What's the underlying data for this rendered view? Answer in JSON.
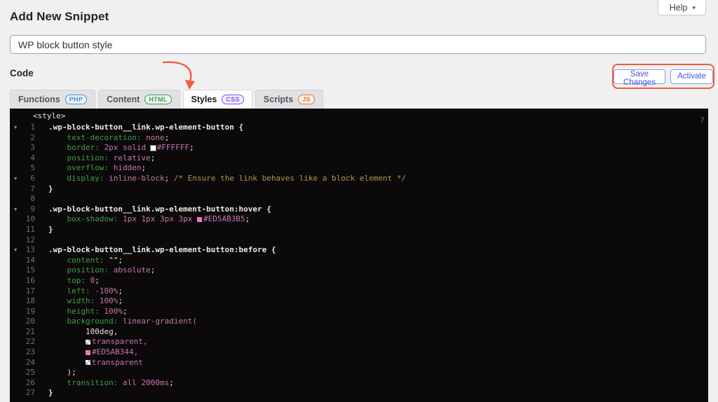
{
  "header": {
    "title": "Add New Snippet",
    "help_label": "Help",
    "help_caret": "▾"
  },
  "snippet": {
    "title_value": "WP block button style"
  },
  "code_section": {
    "label": "Code"
  },
  "actions": {
    "save_label": "Save Changes",
    "activate_label": "Activate"
  },
  "annotation": {
    "color": "#f15c3d"
  },
  "tabs": [
    {
      "label": "Functions",
      "badge": "PHP",
      "badge_color": "#4a8fd3",
      "badge_bg": "#eef4fb",
      "active": false
    },
    {
      "label": "Content",
      "badge": "HTML",
      "badge_color": "#42995a",
      "badge_bg": "#edf6ef",
      "active": false
    },
    {
      "label": "Styles",
      "badge": "CSS",
      "badge_color": "#8055f0",
      "badge_bg": "#f3eefe",
      "active": true
    },
    {
      "label": "Scripts",
      "badge": "JS",
      "badge_color": "#de7430",
      "badge_bg": "#fdf2ea",
      "active": false
    }
  ],
  "editor": {
    "bg": "#0c090a",
    "help_icon": "?",
    "header_line": "<style>",
    "fold_glyph": "▼",
    "colors": {
      "selector": "#ece9e6",
      "property": "#3da044",
      "value": "#c478ad",
      "comment": "#ab9b4a",
      "plain": "#e6e3df",
      "line_number": "#707070",
      "fold": "#8f8f8f"
    },
    "swatches": {
      "white": "#FFFFFF",
      "pink": "#ED5AB3"
    },
    "lines": [
      {
        "n": 1,
        "fold": true,
        "segs": [
          [
            "sel",
            ".wp-block-button__link.wp-element-button {"
          ]
        ]
      },
      {
        "n": 2,
        "fold": false,
        "segs": [
          [
            "plain",
            "    "
          ],
          [
            "prop",
            "text-decoration:"
          ],
          [
            "plain",
            " "
          ],
          [
            "val",
            "none"
          ],
          [
            "plain",
            ";"
          ]
        ]
      },
      {
        "n": 3,
        "fold": false,
        "segs": [
          [
            "plain",
            "    "
          ],
          [
            "prop",
            "border:"
          ],
          [
            "plain",
            " "
          ],
          [
            "val",
            "2px solid "
          ],
          [
            "sw",
            "white"
          ],
          [
            "val",
            "#FFFFFF"
          ],
          [
            "plain",
            ";"
          ]
        ]
      },
      {
        "n": 4,
        "fold": false,
        "segs": [
          [
            "plain",
            "    "
          ],
          [
            "prop",
            "position:"
          ],
          [
            "plain",
            " "
          ],
          [
            "val",
            "relative"
          ],
          [
            "plain",
            ";"
          ]
        ]
      },
      {
        "n": 5,
        "fold": false,
        "segs": [
          [
            "plain",
            "    "
          ],
          [
            "prop",
            "overflow:"
          ],
          [
            "plain",
            " "
          ],
          [
            "val",
            "hidden"
          ],
          [
            "plain",
            ";"
          ]
        ]
      },
      {
        "n": 6,
        "fold": true,
        "segs": [
          [
            "plain",
            "    "
          ],
          [
            "prop",
            "display:"
          ],
          [
            "plain",
            " "
          ],
          [
            "val",
            "inline-block"
          ],
          [
            "plain",
            "; "
          ],
          [
            "comment",
            "/* Ensure the link behaves like a block element */"
          ]
        ]
      },
      {
        "n": 7,
        "fold": false,
        "segs": [
          [
            "sel",
            "}"
          ]
        ]
      },
      {
        "n": 8,
        "fold": false,
        "segs": []
      },
      {
        "n": 9,
        "fold": true,
        "segs": [
          [
            "sel",
            ".wp-block-button__link.wp-element-button:hover {"
          ]
        ]
      },
      {
        "n": 10,
        "fold": false,
        "segs": [
          [
            "plain",
            "    "
          ],
          [
            "prop",
            "box-shadow:"
          ],
          [
            "plain",
            " "
          ],
          [
            "val",
            "1px 1px 3px 3px "
          ],
          [
            "sw",
            "pink"
          ],
          [
            "val",
            "#ED5AB3B5"
          ],
          [
            "plain",
            ";"
          ]
        ]
      },
      {
        "n": 11,
        "fold": false,
        "segs": [
          [
            "sel",
            "}"
          ]
        ]
      },
      {
        "n": 12,
        "fold": false,
        "segs": []
      },
      {
        "n": 13,
        "fold": true,
        "segs": [
          [
            "sel",
            ".wp-block-button__link.wp-element-button:before {"
          ]
        ]
      },
      {
        "n": 14,
        "fold": false,
        "segs": [
          [
            "plain",
            "    "
          ],
          [
            "prop",
            "content:"
          ],
          [
            "plain",
            " \"\";"
          ]
        ]
      },
      {
        "n": 15,
        "fold": false,
        "segs": [
          [
            "plain",
            "    "
          ],
          [
            "prop",
            "position:"
          ],
          [
            "plain",
            " "
          ],
          [
            "val",
            "absolute"
          ],
          [
            "plain",
            ";"
          ]
        ]
      },
      {
        "n": 16,
        "fold": false,
        "segs": [
          [
            "plain",
            "    "
          ],
          [
            "prop",
            "top:"
          ],
          [
            "plain",
            " "
          ],
          [
            "val",
            "0"
          ],
          [
            "plain",
            ";"
          ]
        ]
      },
      {
        "n": 17,
        "fold": false,
        "segs": [
          [
            "plain",
            "    "
          ],
          [
            "prop",
            "left:"
          ],
          [
            "plain",
            " "
          ],
          [
            "val",
            "-100%"
          ],
          [
            "plain",
            ";"
          ]
        ]
      },
      {
        "n": 18,
        "fold": false,
        "segs": [
          [
            "plain",
            "    "
          ],
          [
            "prop",
            "width:"
          ],
          [
            "plain",
            " "
          ],
          [
            "val",
            "100%"
          ],
          [
            "plain",
            ";"
          ]
        ]
      },
      {
        "n": 19,
        "fold": false,
        "segs": [
          [
            "plain",
            "    "
          ],
          [
            "prop",
            "height:"
          ],
          [
            "plain",
            " "
          ],
          [
            "val",
            "100%"
          ],
          [
            "plain",
            ";"
          ]
        ]
      },
      {
        "n": 20,
        "fold": false,
        "segs": [
          [
            "plain",
            "    "
          ],
          [
            "prop",
            "background:"
          ],
          [
            "plain",
            " "
          ],
          [
            "val",
            "linear-gradient("
          ]
        ]
      },
      {
        "n": 21,
        "fold": false,
        "segs": [
          [
            "plain",
            "        100deg,"
          ]
        ]
      },
      {
        "n": 22,
        "fold": false,
        "segs": [
          [
            "plain",
            "        "
          ],
          [
            "sw",
            "checker"
          ],
          [
            "val",
            "transparent,"
          ]
        ]
      },
      {
        "n": 23,
        "fold": false,
        "segs": [
          [
            "plain",
            "        "
          ],
          [
            "sw",
            "pink"
          ],
          [
            "val",
            "#ED5AB344,"
          ]
        ]
      },
      {
        "n": 24,
        "fold": false,
        "segs": [
          [
            "plain",
            "        "
          ],
          [
            "sw",
            "checker"
          ],
          [
            "val",
            "transparent"
          ]
        ]
      },
      {
        "n": 25,
        "fold": false,
        "segs": [
          [
            "plain",
            "    );"
          ]
        ]
      },
      {
        "n": 26,
        "fold": false,
        "segs": [
          [
            "plain",
            "    "
          ],
          [
            "prop",
            "transition:"
          ],
          [
            "plain",
            " "
          ],
          [
            "val",
            "all 2000ms"
          ],
          [
            "plain",
            ";"
          ]
        ]
      },
      {
        "n": 27,
        "fold": false,
        "segs": [
          [
            "sel",
            "}"
          ]
        ]
      }
    ]
  }
}
